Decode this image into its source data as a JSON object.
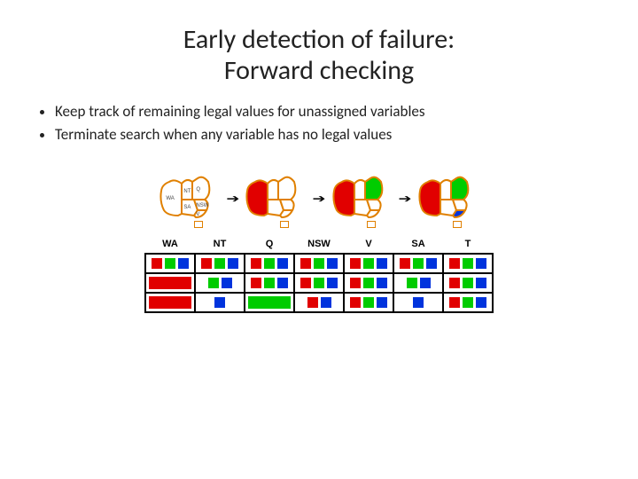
{
  "title_line1": "Early detection of failure:",
  "title_line2": "Forward checking",
  "bullets": [
    "Keep track of remaining legal values for unassigned variables",
    "Terminate search when any variable has no legal values"
  ],
  "headers": [
    "WA",
    "NT",
    "Q",
    "NSW",
    "V",
    "SA",
    "T"
  ],
  "map_labels": {
    "WA": "WA",
    "NT": "NT",
    "Q": "Q",
    "SA": "SA",
    "NSW": "NSW",
    "V": "V"
  },
  "maps": [
    {
      "WA": "none",
      "NT": "none",
      "Q": "none",
      "SA": "none",
      "NSW": "none",
      "V": "none"
    },
    {
      "WA": "R",
      "NT": "none",
      "Q": "none",
      "SA": "none",
      "NSW": "none",
      "V": "none"
    },
    {
      "WA": "R",
      "NT": "none",
      "Q": "G",
      "SA": "none",
      "NSW": "none",
      "V": "none"
    },
    {
      "WA": "R",
      "NT": "none",
      "Q": "G",
      "SA": "none",
      "NSW": "none",
      "V": "B"
    }
  ],
  "rows": [
    {
      "WA": [
        "R",
        "G",
        "B"
      ],
      "NT": [
        "R",
        "G",
        "B"
      ],
      "Q": [
        "R",
        "G",
        "B"
      ],
      "NSW": [
        "R",
        "G",
        "B"
      ],
      "V": [
        "R",
        "G",
        "B"
      ],
      "SA": [
        "R",
        "G",
        "B"
      ],
      "T": [
        "R",
        "G",
        "B"
      ]
    },
    {
      "WA": [
        "R_fill"
      ],
      "NT": [
        "G",
        "B"
      ],
      "Q": [
        "R",
        "G",
        "B"
      ],
      "NSW": [
        "R",
        "G",
        "B"
      ],
      "V": [
        "R",
        "G",
        "B"
      ],
      "SA": [
        "G",
        "B"
      ],
      "T": [
        "R",
        "G",
        "B"
      ]
    },
    {
      "WA": [
        "R_fill"
      ],
      "NT": [
        "B"
      ],
      "Q": [
        "G_fill"
      ],
      "NSW": [
        "R",
        "B"
      ],
      "V": [
        "R",
        "G",
        "B"
      ],
      "SA": [
        "B"
      ],
      "T": [
        "R",
        "G",
        "B"
      ]
    }
  ],
  "colors": {
    "R": "#e10000",
    "G": "#00cc00",
    "B": "#0033dd",
    "outline": "#e08000"
  }
}
